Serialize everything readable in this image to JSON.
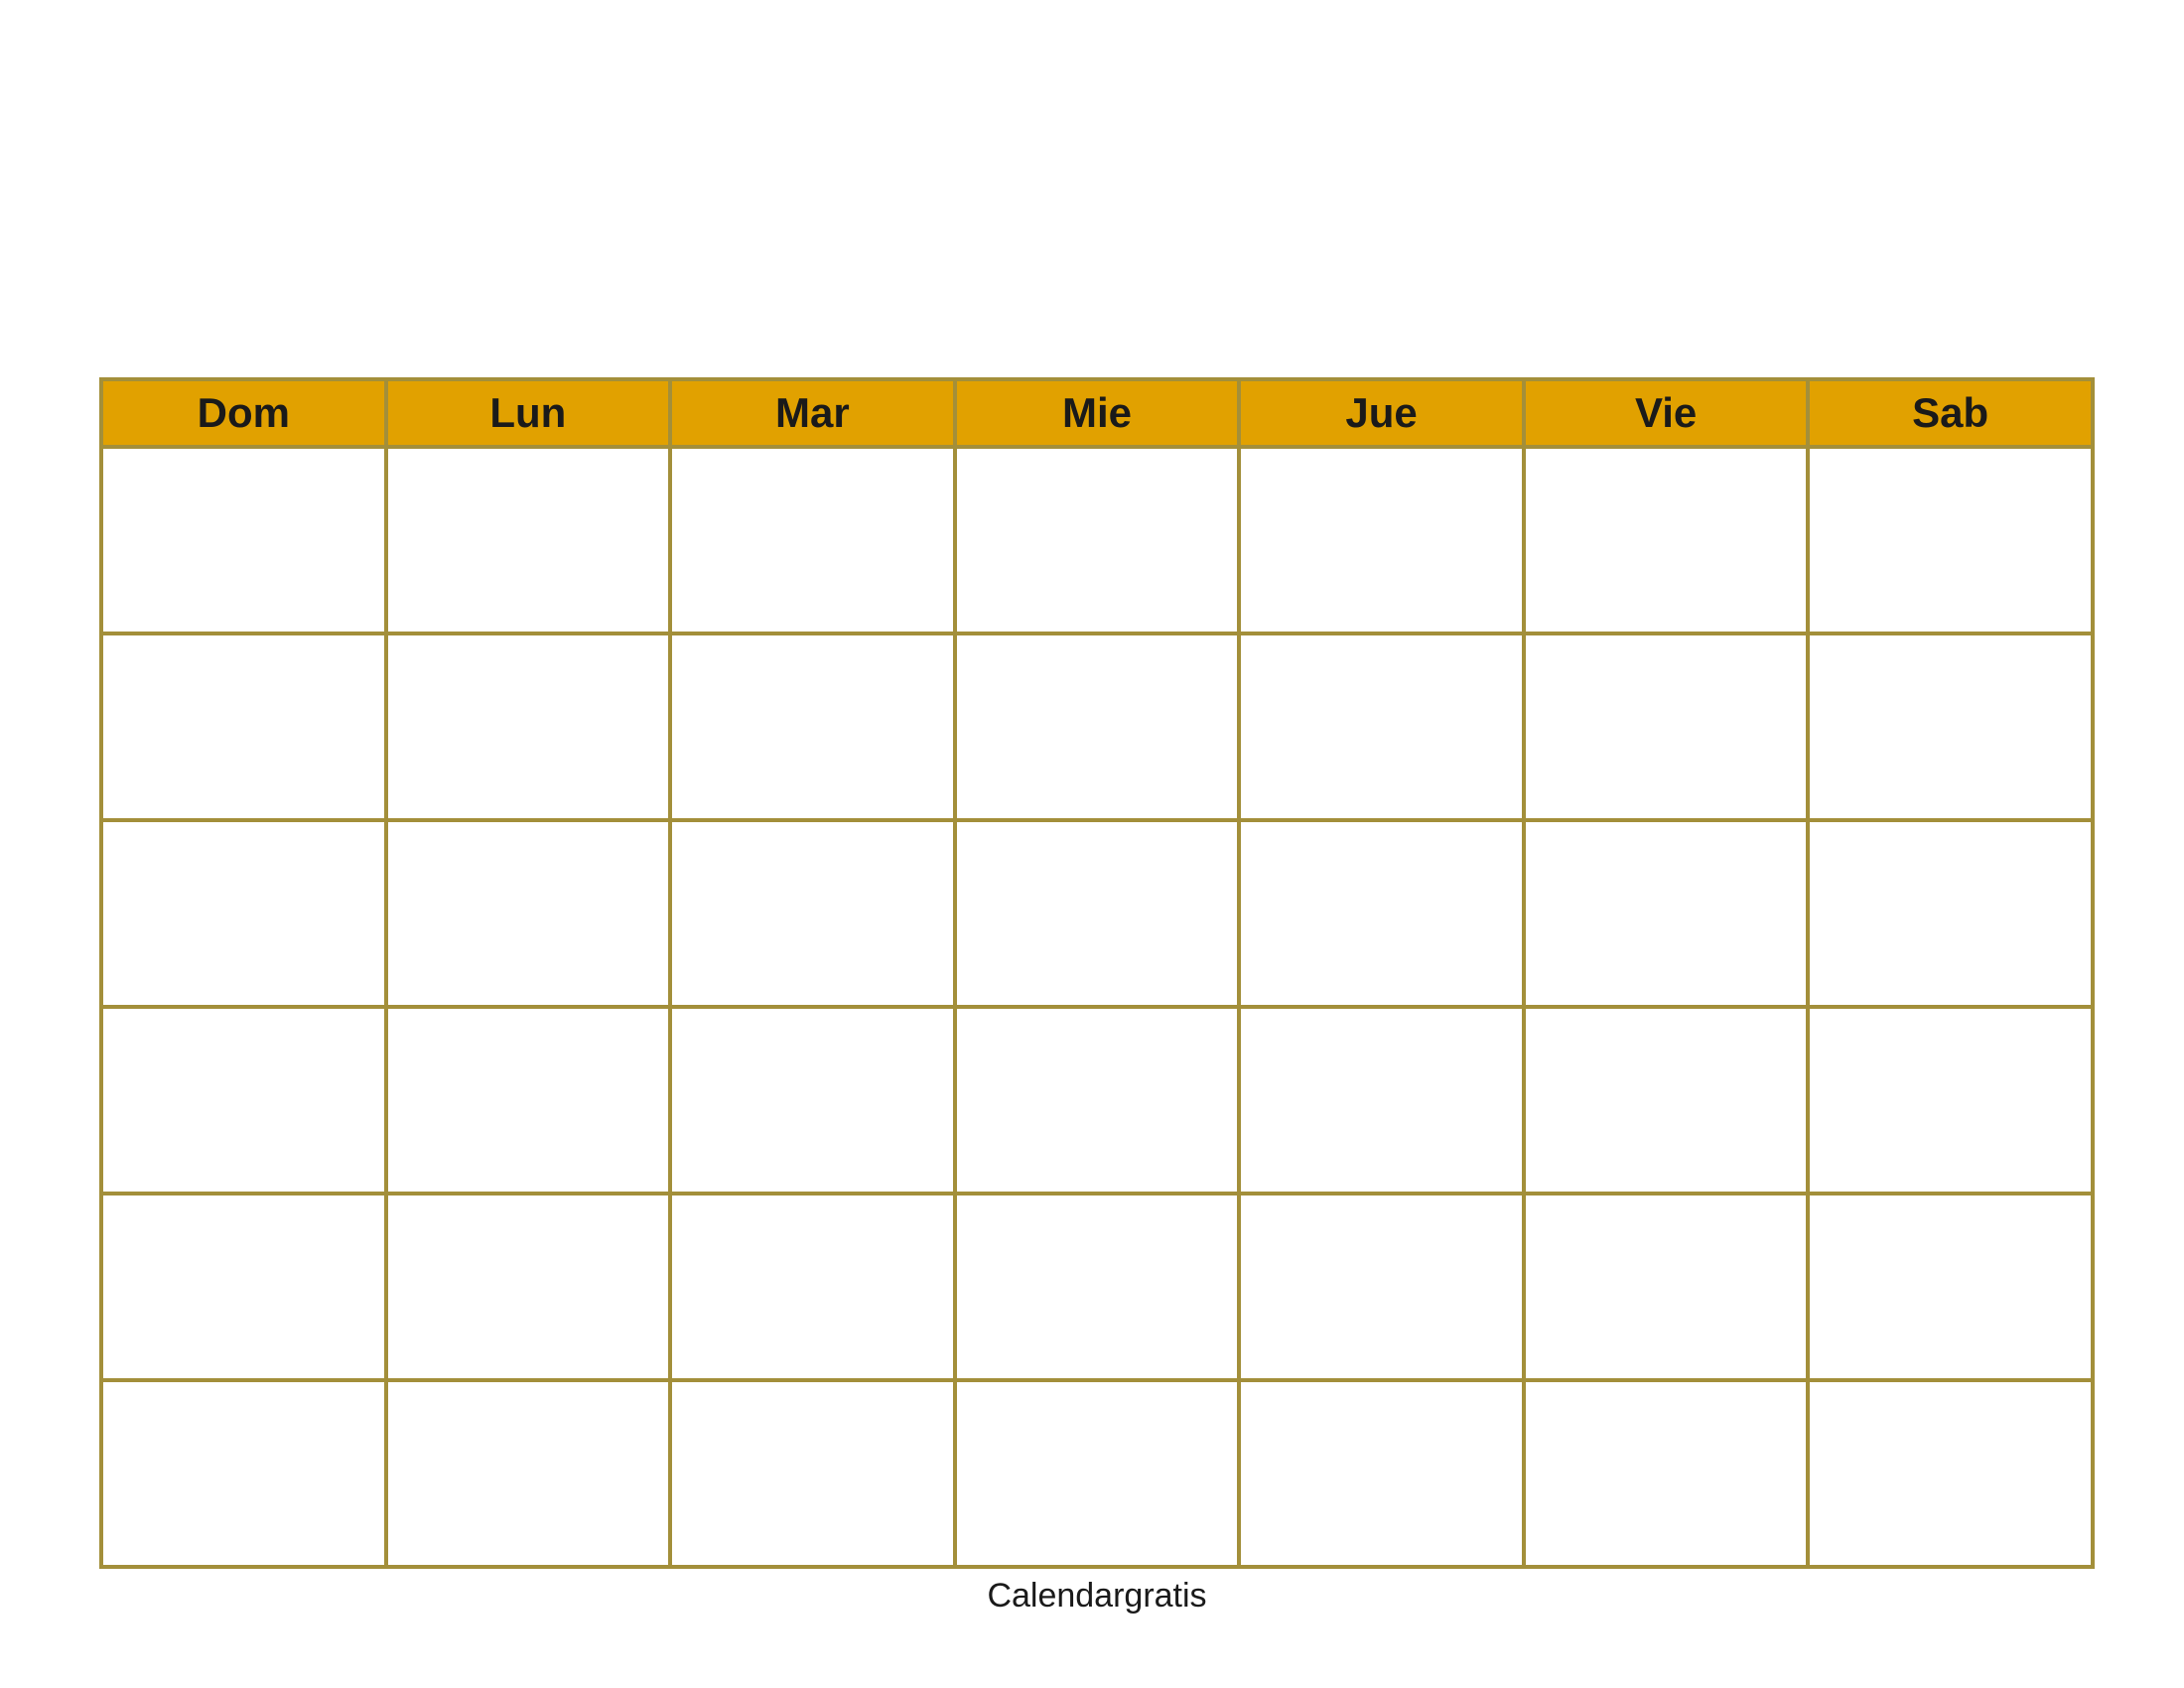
{
  "calendar": {
    "headers": [
      "Dom",
      "Lun",
      "Mar",
      "Mie",
      "Jue",
      "Vie",
      "Sab"
    ],
    "rows": 6,
    "cells": [
      [
        "",
        "",
        "",
        "",
        "",
        "",
        ""
      ],
      [
        "",
        "",
        "",
        "",
        "",
        "",
        ""
      ],
      [
        "",
        "",
        "",
        "",
        "",
        "",
        ""
      ],
      [
        "",
        "",
        "",
        "",
        "",
        "",
        ""
      ],
      [
        "",
        "",
        "",
        "",
        "",
        "",
        ""
      ],
      [
        "",
        "",
        "",
        "",
        "",
        "",
        ""
      ]
    ]
  },
  "footer": "Calendargratis",
  "colors": {
    "header_bg": "#e1a100",
    "border": "#a38f3a",
    "text": "#1a1a1a"
  }
}
